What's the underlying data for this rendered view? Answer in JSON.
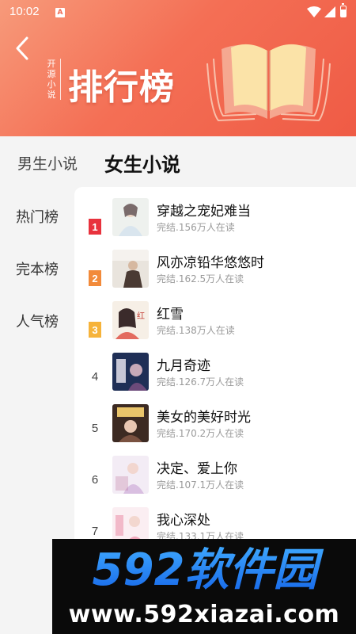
{
  "status_bar": {
    "time": "10:02",
    "indicator": "A"
  },
  "header": {
    "brand_vertical": [
      "开",
      "源",
      "小",
      "说"
    ],
    "title": "排行榜",
    "icons": {
      "back": "back-arrow-icon",
      "hero": "open-book-icon"
    },
    "colors": {
      "gradient_start": "#f79a7a",
      "gradient_end": "#ef5b45"
    }
  },
  "top_tabs": [
    {
      "label": "男生小说",
      "active": false
    },
    {
      "label": "女生小说",
      "active": true
    }
  ],
  "side_nav": [
    {
      "label": "热门榜",
      "active": true
    },
    {
      "label": "完本榜",
      "active": false
    },
    {
      "label": "人气榜",
      "active": false
    }
  ],
  "books": [
    {
      "rank": "1",
      "title": "穿越之宠妃难当",
      "meta": "完结.156万人在读",
      "cover_label": ""
    },
    {
      "rank": "2",
      "title": "风亦凉铅华悠悠时",
      "meta": "完结.162.5万人在读",
      "cover_label": ""
    },
    {
      "rank": "3",
      "title": "红雪",
      "meta": "完结.138万人在读",
      "cover_label": ""
    },
    {
      "rank": "4",
      "title": "九月奇迹",
      "meta": "完结.126.7万人在读",
      "cover_label": ""
    },
    {
      "rank": "5",
      "title": "美女的美好时光",
      "meta": "完结.170.2万人在读",
      "cover_label": ""
    },
    {
      "rank": "6",
      "title": "决定、爱上你",
      "meta": "完结.107.1万人在读",
      "cover_label": ""
    },
    {
      "rank": "7",
      "title": "我心深处",
      "meta": "完结.133.1万人在读",
      "cover_label": ""
    }
  ],
  "rank_badge_colors": [
    "#e8323d",
    "#f28a3a",
    "#f6b33a"
  ],
  "watermark": {
    "logo": "592软件园",
    "url": "www.592xiazai.com"
  }
}
